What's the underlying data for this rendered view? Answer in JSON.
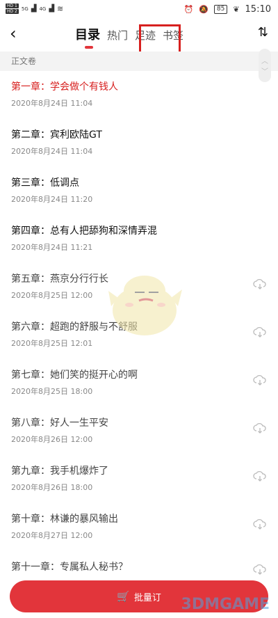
{
  "status": {
    "time": "15:10",
    "battery": "85",
    "hd1": "HD 1",
    "hd2": "HD 2",
    "sig": "5G",
    "sig2": "4G"
  },
  "header": {
    "back_icon": "chevron-left-icon",
    "tabs": [
      {
        "label": "目录",
        "active": true
      },
      {
        "label": "热门"
      },
      {
        "label": "足迹"
      },
      {
        "label": "书签"
      }
    ],
    "sort_icon": "⇅"
  },
  "volume": "正文卷",
  "chapters": [
    {
      "title": "第一章：学会做个有钱人",
      "date": "2020年8月24日 11:04",
      "state": "current"
    },
    {
      "title": "第二章：宾利欧陆GT",
      "date": "2020年8月24日 11:04",
      "state": "read"
    },
    {
      "title": "第三章：低调点",
      "date": "2020年8月24日 11:20",
      "state": "read"
    },
    {
      "title": "第四章：总有人把舔狗和深情弄混",
      "date": "2020年8月24日 11:21",
      "state": "read"
    },
    {
      "title": "第五章：燕京分行行长",
      "date": "2020年8月25日 12:00",
      "state": "cloud"
    },
    {
      "title": "第六章：超跑的舒服与不舒服",
      "date": "2020年8月25日 12:01",
      "state": "cloud"
    },
    {
      "title": "第七章：她们笑的挺开心的啊",
      "date": "2020年8月25日 18:00",
      "state": "cloud"
    },
    {
      "title": "第八章：好人一生平安",
      "date": "2020年8月26日 12:00",
      "state": "cloud"
    },
    {
      "title": "第九章：我手机爆炸了",
      "date": "2020年8月26日 18:00",
      "state": "cloud"
    },
    {
      "title": "第十章：林谦的暴风输出",
      "date": "2020年8月27日 12:00",
      "state": "cloud"
    },
    {
      "title": "第十一章：专属私人秘书？",
      "date": "",
      "state": "cloud"
    }
  ],
  "batch_button": "批量订",
  "watermark": "3DMGAME",
  "colors": {
    "accent": "#e2353b",
    "highlight": "#d7201f"
  }
}
